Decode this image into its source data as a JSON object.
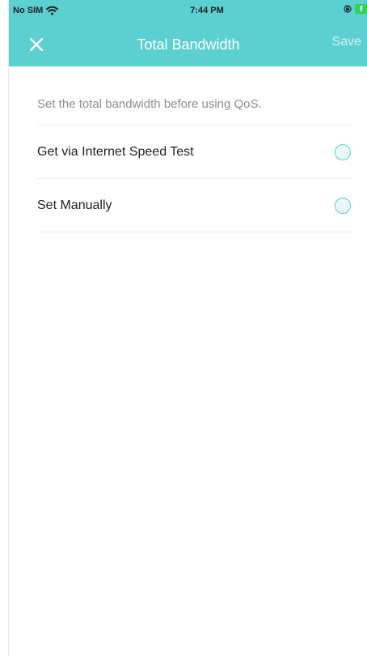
{
  "status_bar": {
    "carrier": "No SIM",
    "time": "7:44 PM"
  },
  "navigation": {
    "title": "Total Bandwidth",
    "save_label": "Save",
    "close_icon": "close-icon"
  },
  "content": {
    "hint": "Set the total bandwidth before using QoS.",
    "options": [
      {
        "label": "Get via Internet Speed Test",
        "selected": false
      },
      {
        "label": "Set Manually",
        "selected": false
      }
    ]
  },
  "colors": {
    "header": "#5ccfd1",
    "radio_border": "#5ccfd1",
    "radio_fill": "#eaf8f9",
    "battery": "#2fd34f"
  }
}
